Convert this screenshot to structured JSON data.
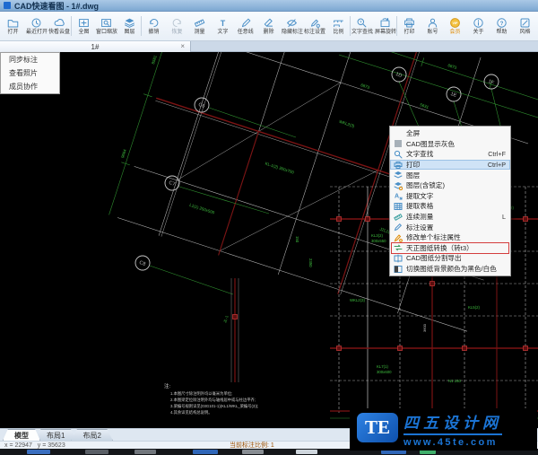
{
  "window": {
    "title": "CAD快速看图 - 1#.dwg"
  },
  "toolbar": {
    "items": [
      {
        "label": "打开"
      },
      {
        "label": "最近打开"
      },
      {
        "label": "快看云盘"
      },
      {
        "label": "全图"
      },
      {
        "label": "窗口缩放"
      },
      {
        "label": "图层"
      },
      {
        "label": "撤销"
      },
      {
        "label": "恢复"
      },
      {
        "label": "测量"
      },
      {
        "label": "文字"
      },
      {
        "label": "任意线"
      },
      {
        "label": "删除"
      },
      {
        "label": "隐藏标注"
      },
      {
        "label": "标注设置"
      },
      {
        "label": "比例"
      },
      {
        "label": "文字查找"
      },
      {
        "label": "屏幕旋转"
      },
      {
        "label": "打印"
      },
      {
        "label": "账号"
      },
      {
        "label": "会员"
      },
      {
        "label": "关于"
      },
      {
        "label": "帮助"
      },
      {
        "label": "风格"
      }
    ]
  },
  "doc_tab": {
    "label": "1#",
    "close": "×"
  },
  "left_menu": {
    "items": [
      {
        "label": "同步标注"
      },
      {
        "label": "查看照片"
      },
      {
        "label": "成员协作"
      }
    ]
  },
  "context_menu": {
    "items": [
      {
        "label": "全屏",
        "shortcut": ""
      },
      {
        "label": "CAD图显示灰色",
        "shortcut": ""
      },
      {
        "label": "文字查找",
        "shortcut": "Ctrl+F"
      },
      {
        "label": "打印",
        "shortcut": "Ctrl+P"
      },
      {
        "label": "图层",
        "shortcut": ""
      },
      {
        "label": "图层(含锁定)",
        "shortcut": ""
      },
      {
        "label": "提取文字",
        "shortcut": ""
      },
      {
        "label": "提取表格",
        "shortcut": ""
      },
      {
        "label": "连续测量",
        "shortcut": "L"
      },
      {
        "label": "标注设置",
        "shortcut": ""
      },
      {
        "label": "修改单个标注属性",
        "shortcut": ""
      },
      {
        "label": "天正图纸转换（转t3）",
        "shortcut": ""
      },
      {
        "label": "CAD图纸分割导出",
        "shortcut": ""
      },
      {
        "label": "切换图纸背景颜色为黑色/白色",
        "shortcut": ""
      }
    ]
  },
  "canvas": {
    "bubbles": [
      "C6",
      "C7",
      "C8",
      "1D",
      "1E",
      "1F"
    ],
    "dims": [
      "3574",
      "12584",
      "5631",
      "6873",
      "8581",
      "9664",
      "2400",
      "3600",
      "2100",
      "4500",
      "3300",
      "150",
      "2350"
    ],
    "beam_labels": [
      "KL-1(2) 300x700",
      "WKL2(3)",
      "L1(1) 250x500",
      "JZL1(2)",
      "KL3(2)",
      "300x550",
      "L1(1)",
      "250x500",
      "WKL2(3)",
      "KL5(2)",
      "KL6(2)",
      "KL7(1)",
      "300x600",
      "N1 150",
      "JL-1"
    ],
    "notes": {
      "title": "注:",
      "lines": [
        "1.本图尺寸除注明外均以毫米为单位;",
        "2.本图梁定位除注明外均与轴线居中或与柱边平齐;",
        "3.梁编号规则详见(03G101-1)(KL1/WKL_梁编号(3));",
        "4.其余详见结构总说明。"
      ]
    }
  },
  "bottom": {
    "layout_tabs": [
      "模型",
      "布局1",
      "布局2"
    ],
    "coords": "x = 22947   y = 35623",
    "scale_text": "当前标注比例: 1"
  },
  "watermark": {
    "logo": "TE",
    "site_name": "四五设计网",
    "url": "www.45te.com"
  },
  "colors": {
    "accent": "#4a8fc7",
    "cad_green": "#3fbf3f",
    "beam_red": "#7c1313",
    "highlight_red": "#d43c3c",
    "vip_yellow": "#f3c13f",
    "watermark_blue": "#1b74d4"
  }
}
